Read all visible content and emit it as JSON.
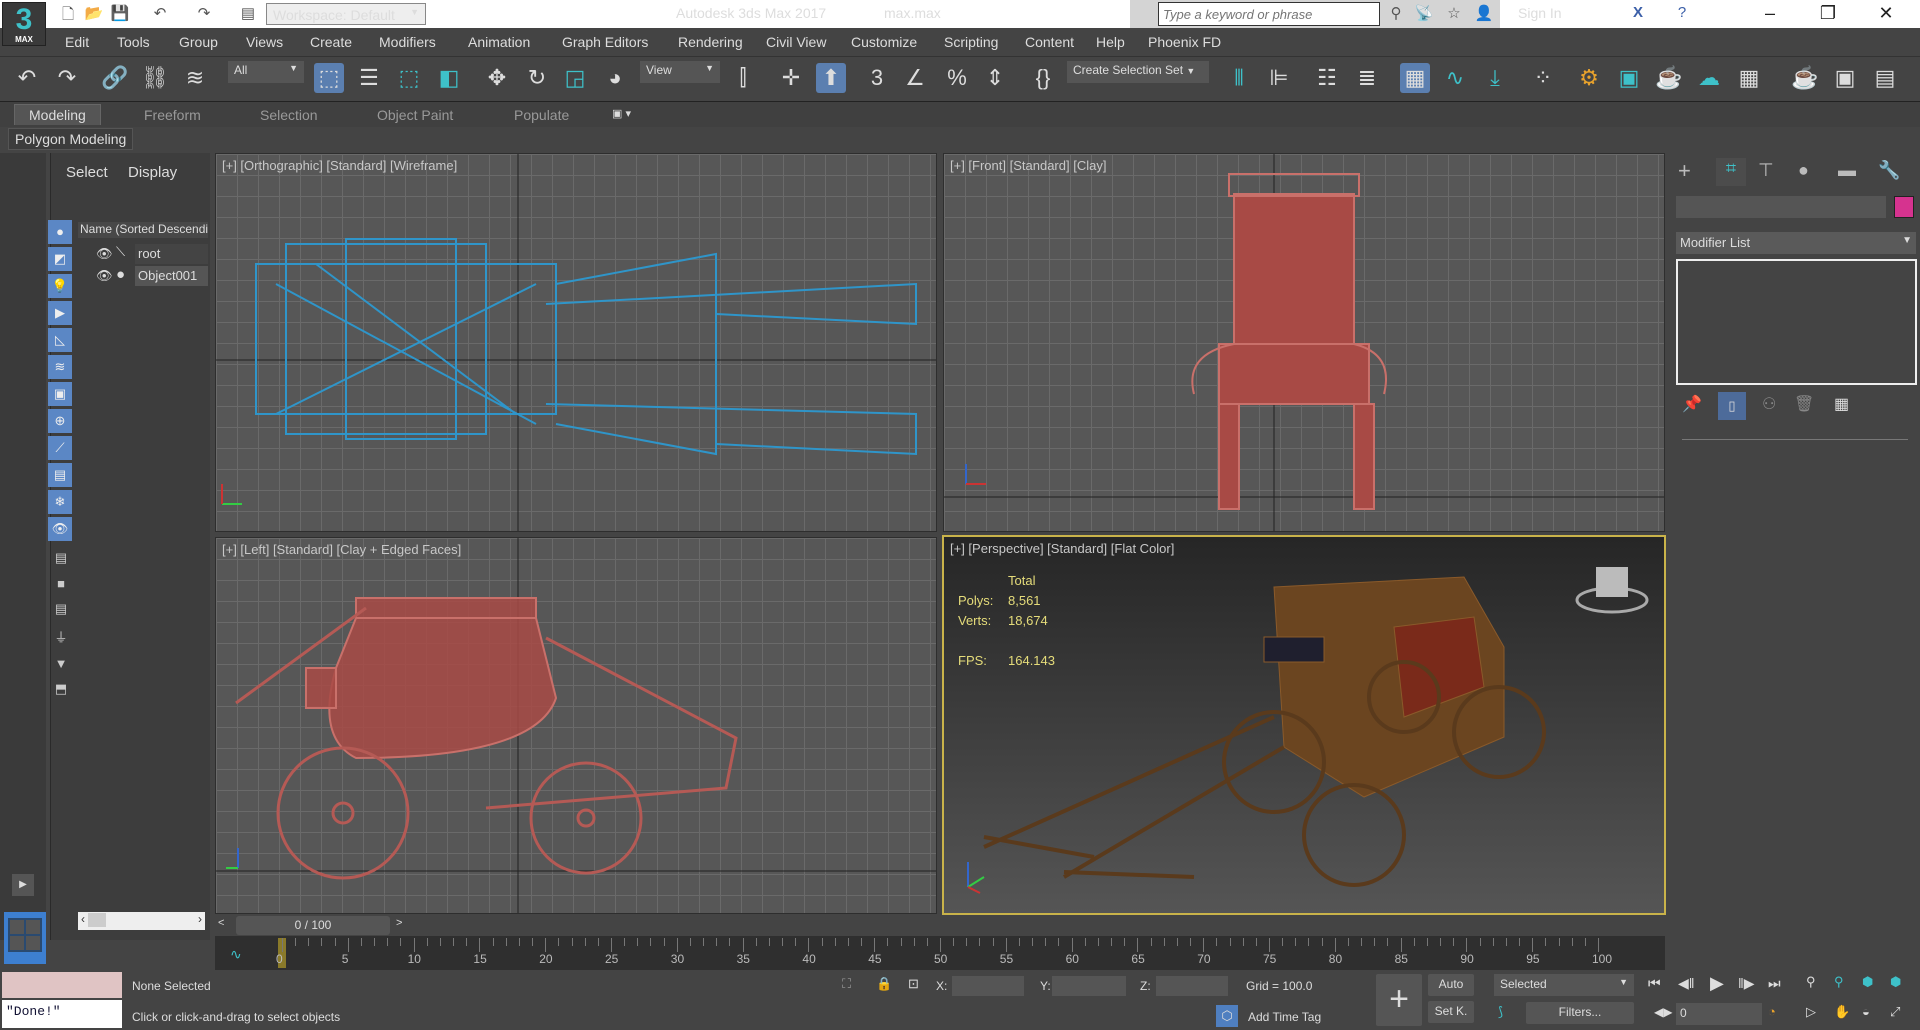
{
  "titlebar": {
    "app_title": "Autodesk 3ds Max 2017",
    "file_name": "max.max",
    "workspace": "Workspace: Default",
    "search_placeholder": "Type a keyword or phrase",
    "sign_in": "Sign In",
    "logo": "3",
    "logo_sub": "MAX"
  },
  "menu": [
    "Edit",
    "Tools",
    "Group",
    "Views",
    "Create",
    "Modifiers",
    "Animation",
    "Graph Editors",
    "Rendering",
    "Civil View",
    "Customize",
    "Scripting",
    "Content",
    "Help",
    "Phoenix FD"
  ],
  "toolbar": {
    "filter": "All",
    "ref_coord": "View",
    "selection_set": "Create Selection Set"
  },
  "ribbon": {
    "tabs": [
      "Modeling",
      "Freeform",
      "Selection",
      "Object Paint",
      "Populate"
    ],
    "panel": "Polygon Modeling"
  },
  "explorer": {
    "tabs": [
      "Select",
      "Display"
    ],
    "column": "Name (Sorted Descending)",
    "items": [
      "root",
      "Object001"
    ]
  },
  "viewports": {
    "top_left": "[+] [Orthographic] [Standard] [Wireframe]",
    "top_right": "[+] [Front] [Standard] [Clay]",
    "bottom_left": "[+] [Left] [Standard] [Clay + Edged Faces]",
    "bottom_right": "[+] [Perspective] [Standard] [Flat Color]",
    "stats": {
      "header": "Total",
      "polys_label": "Polys:",
      "polys": "8,561",
      "verts_label": "Verts:",
      "verts": "18,674",
      "fps_label": "FPS:",
      "fps": "164.143"
    }
  },
  "command_panel": {
    "modifier_list": "Modifier List",
    "object_color": "#d6338f"
  },
  "timeline": {
    "frame": "0 / 100",
    "ticks": [
      "0",
      "5",
      "10",
      "15",
      "20",
      "25",
      "30",
      "35",
      "40",
      "45",
      "50",
      "55",
      "60",
      "65",
      "70",
      "75",
      "80",
      "85",
      "90",
      "95",
      "100"
    ]
  },
  "status": {
    "maxscript_result": "\"Done!\"",
    "selection": "None Selected",
    "prompt": "Click or click-and-drag to select objects",
    "x_label": "X:",
    "y_label": "Y:",
    "z_label": "Z:",
    "grid": "Grid = 100.0",
    "add_time_tag": "Add Time Tag",
    "auto": "Auto",
    "set_key": "Set K.",
    "key_filter": "Selected",
    "filters": "Filters...",
    "current_frame": "0"
  }
}
